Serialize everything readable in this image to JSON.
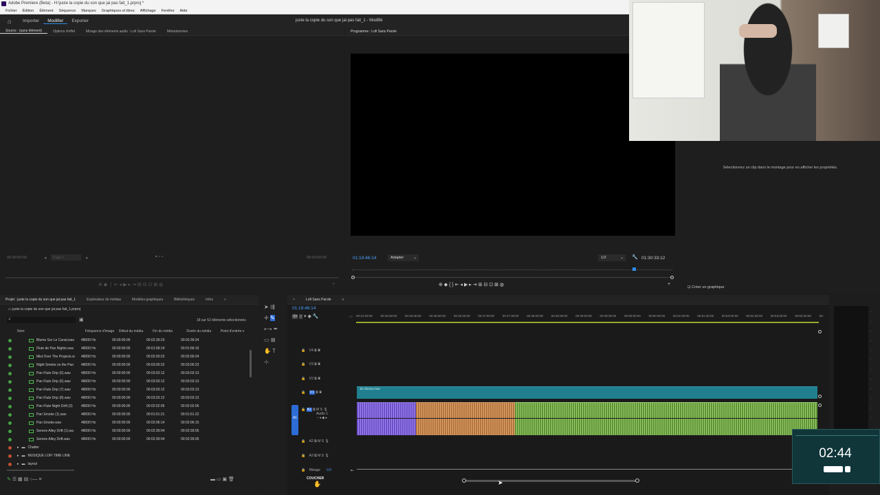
{
  "app": {
    "title": "Adobe Premiere (Beta) - H:\\juste la copie du son que jai pas fait_1.prproj *",
    "menu": [
      "Fichier",
      "Édition",
      "Élément",
      "Séquence",
      "Marques",
      "Graphiques et titres",
      "Affichage",
      "Fenêtre",
      "Aide"
    ],
    "workspace_tabs": [
      "Importer",
      "Modifier",
      "Exporter"
    ],
    "active_tab": "Modifier",
    "window_title": "juste la copie du son que jai pas fait_1 - Modifié"
  },
  "source_panel": {
    "tabs": [
      "Source : (sans élément)",
      "Options d'effet",
      "Mixage des éléments audio : Lofi Sans Parole",
      "Métadonnées"
    ],
    "tc_left": "00:00:00:00",
    "tc_right": "00:00:00:00",
    "page": "Page 1"
  },
  "program_panel": {
    "tab": "Programme : Lofi Sans Parole",
    "timecode": "01:19:46:14",
    "fit": "Adapter",
    "resolution": "1/2",
    "duration": "01:30:33:12"
  },
  "properties": {
    "empty_msg": "Sélectionnez un clip dans le montage pour en afficher les propriétés.",
    "create_graphic": "Créer un graphique"
  },
  "project": {
    "tabs": [
      "Projet : juste la copie du son que jai pas fait_1",
      "Explorateur de médias",
      "Modèles graphiques",
      "Bibliothèques",
      "Infos"
    ],
    "path": "juste la copie du son que jai pas fait_1.prproj",
    "selection": "18 sur 52 éléments sélectionnés",
    "columns": [
      "Nom",
      "Fréquence d'image",
      "Début du média",
      "Fin du média",
      "Durée du média",
      "Point d'entrée v"
    ],
    "rows": [
      [
        "Blume Sur Le Canal.wav",
        "48000  Hz",
        "00:00:00:00",
        "00:02:39:23",
        "00:02:39:24"
      ],
      [
        "Flute de Pan Nights.wav",
        "48000  Hz",
        "00:00:00:00",
        "00:01:58:14",
        "00:01:58:15"
      ],
      [
        "Mist Over The Projects.w",
        "48000  Hz",
        "00:00:00:00",
        "00:02:00:23",
        "00:02:00:24"
      ],
      [
        "Night Smoke on the Pan",
        "48000  Hz",
        "00:00:00:00",
        "00:03:00:22",
        "00:03:00:23"
      ],
      [
        "Pan Flute Drip (5).wav",
        "48000  Hz",
        "00:00:00:00",
        "00:03:03:12",
        "00:03:03:13"
      ],
      [
        "Pan Flute Drip (6).wav",
        "48000  Hz",
        "00:00:00:00",
        "00:03:03:12",
        "00:03:03:13"
      ],
      [
        "Pan Flute Drip (7).wav",
        "48000  Hz",
        "00:00:00:00",
        "00:03:03:12",
        "00:03:03:13"
      ],
      [
        "Pan Flute Drip (8).wav",
        "48000  Hz",
        "00:00:00:00",
        "00:03:03:12",
        "00:03:03:13"
      ],
      [
        "Pan Flute Night Drift (2)",
        "48000  Hz",
        "00:00:00:00",
        "00:02:02:05",
        "00:02:02:06"
      ],
      [
        "Pan Smoke (1).wav",
        "48000  Hz",
        "00:00:00:00",
        "00:01:51:21",
        "00:01:51:22"
      ],
      [
        "Pan Smoke.wav",
        "48000  Hz",
        "00:00:00:00",
        "00:02:06:14",
        "00:02:06:15"
      ],
      [
        "Serene Alley Drift (1).wa",
        "48000  Hz",
        "00:00:00:00",
        "00:02:39:04",
        "00:02:39:05"
      ],
      [
        "Serene Alley Drift.wav",
        "48000  Hz",
        "00:00:00:00",
        "00:02:39:04",
        "00:02:39:05"
      ]
    ],
    "folders": [
      "Chatter",
      "MUSIQUE LOFI TIME LINE",
      "layout"
    ]
  },
  "timeline": {
    "tab": "Lofi Sans Parole",
    "timecode": "01:19:46:14",
    "ruler": [
      "00:44:30:00",
      "00:45:00:00",
      "00:45:30:00",
      "00:46:00:00",
      "00:46:30:00",
      "00:47:00:00",
      "00:47:30:00",
      "00:48:00:00",
      "00:48:30:00",
      "00:49:00:00",
      "00:49:30:00",
      "00:50:00:00",
      "00:50:30:00",
      "00:51:00:00",
      "00:51:30:00",
      "00:52:00:00",
      "00:52:30:00",
      "00:53:00:00",
      "00:53:30:00",
      "00:"
    ],
    "video_tracks": [
      "V4",
      "V3",
      "V2",
      "V1"
    ],
    "audio_tracks": [
      "A1",
      "A2",
      "A3"
    ],
    "audio_track_name": "Audio 1",
    "video_clip": "1h chrono.mov",
    "mix_label": "Mixage",
    "mix_value": "0.0",
    "cursor_label": "COUCHER"
  },
  "overlay": {
    "timer": "02:44"
  },
  "colors": {
    "accent": "#2d8ceb",
    "video_clip": "#1f7f8e",
    "audio_purple": "#7c5fd6",
    "audio_orange": "#c48a4f",
    "audio_green": "#78b04e"
  }
}
